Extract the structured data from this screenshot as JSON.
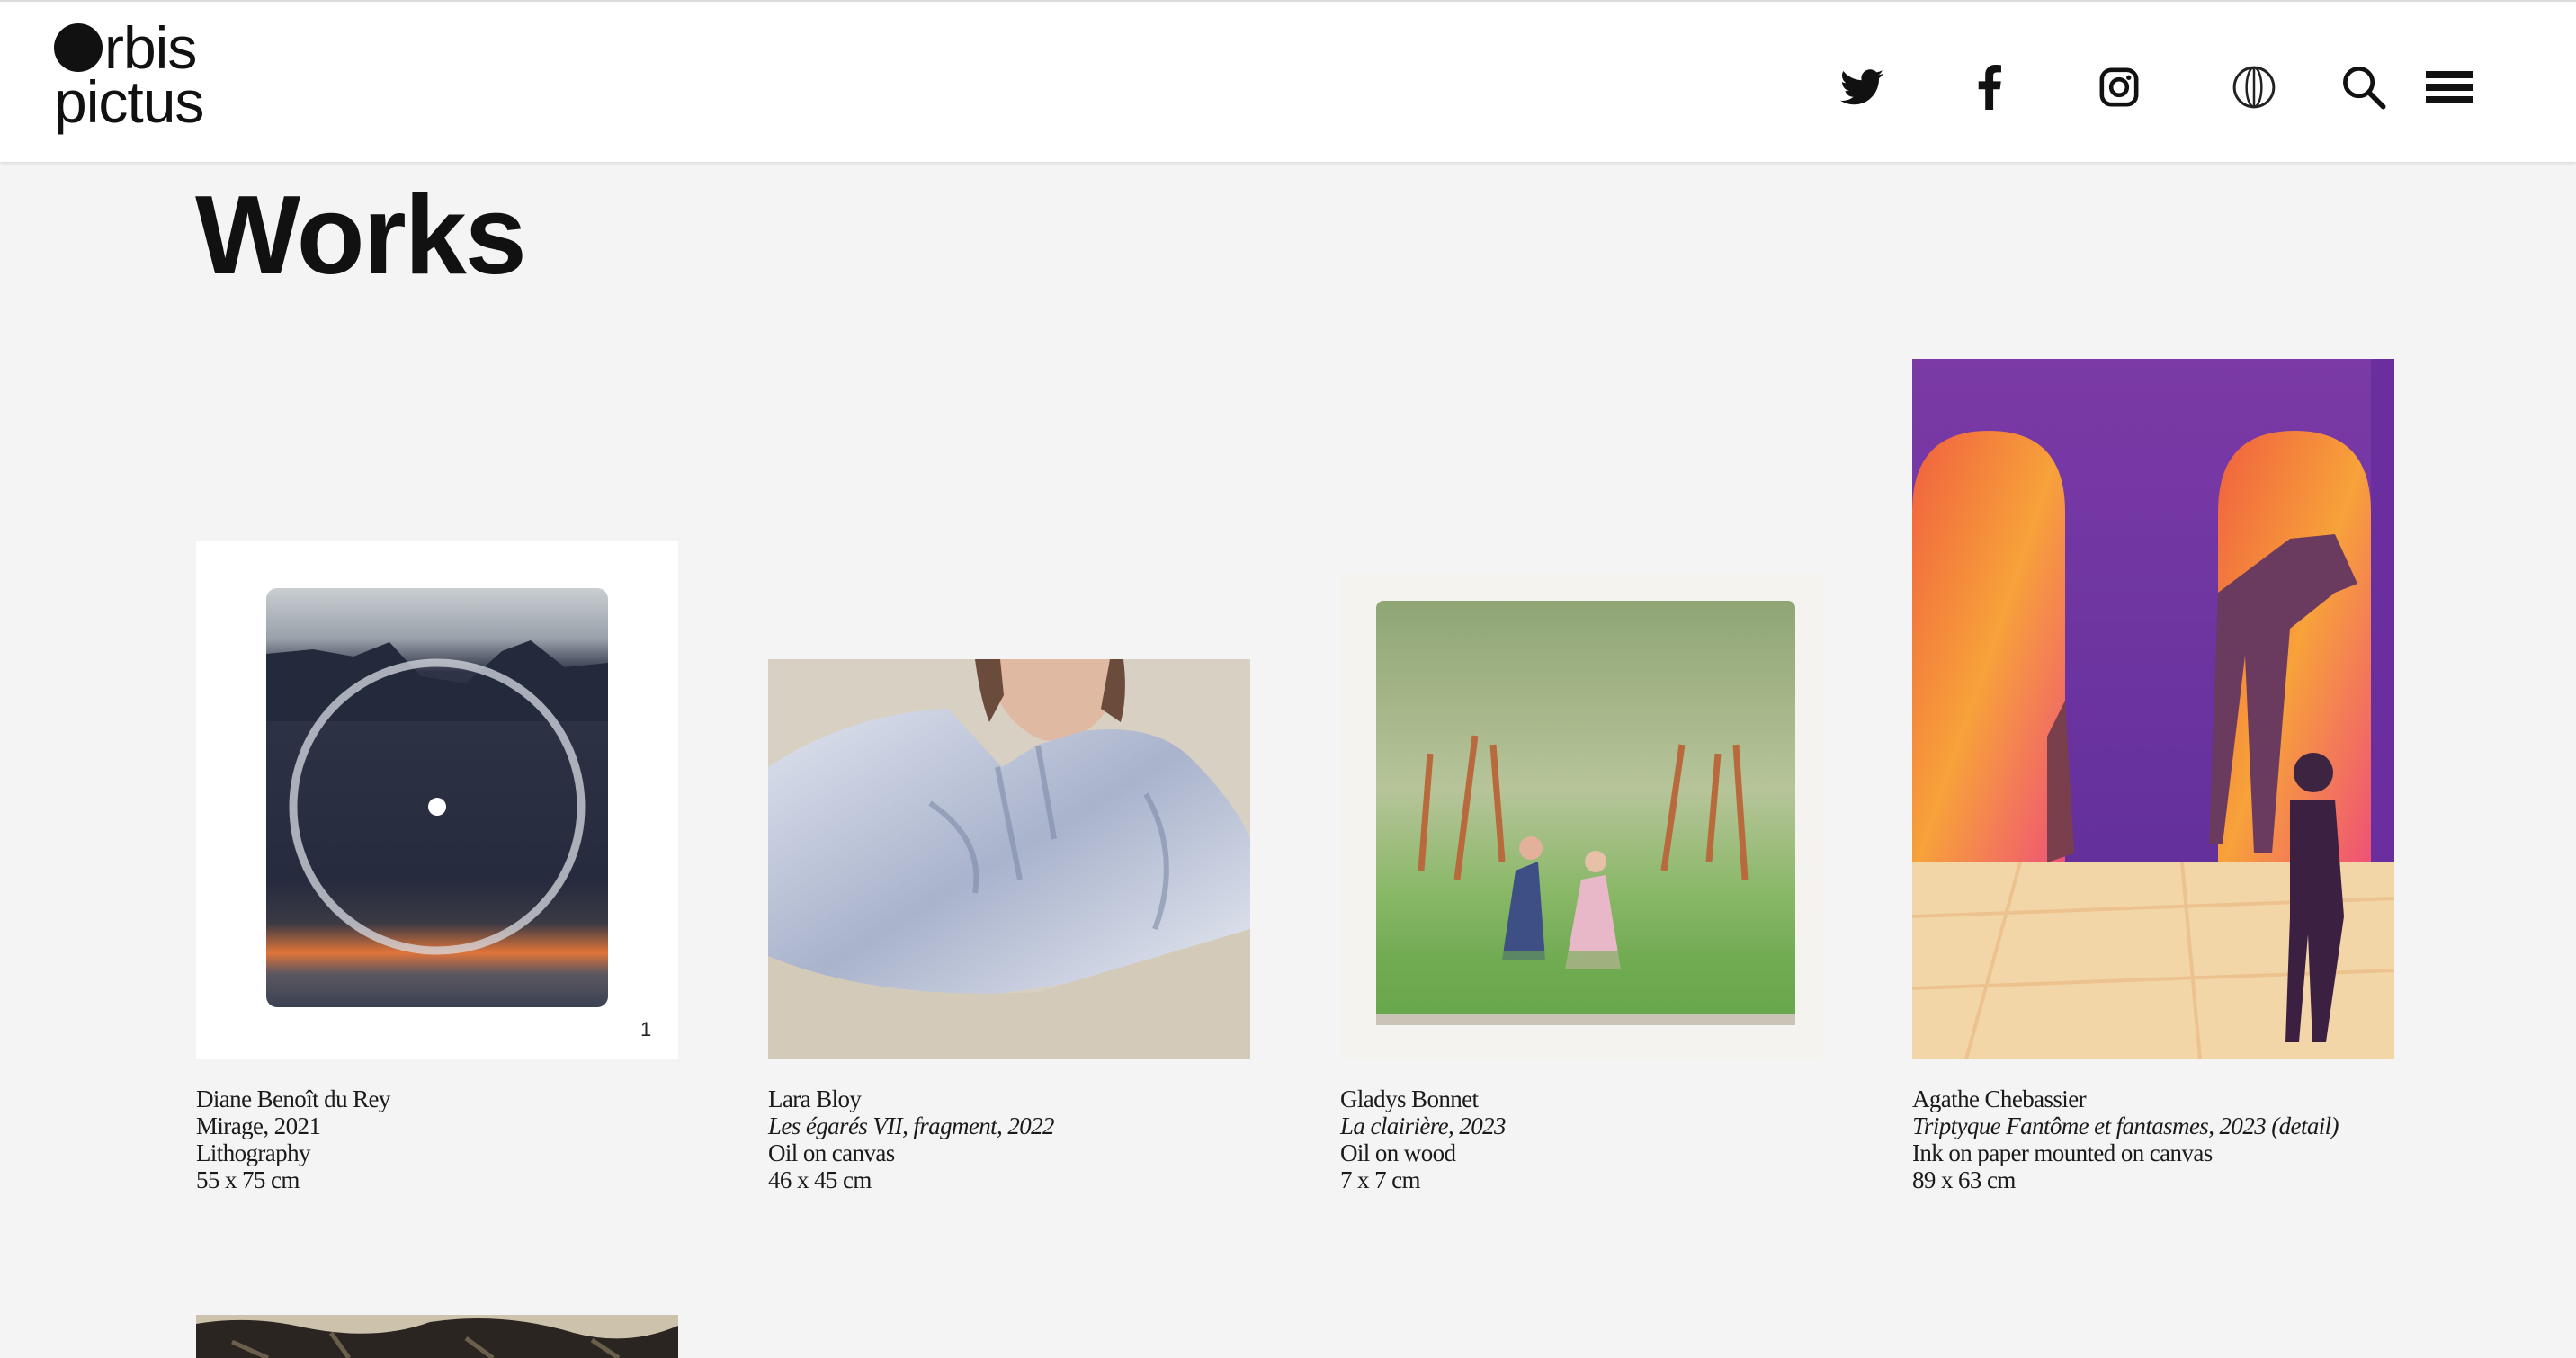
{
  "brand": {
    "logo_line1": "rbis",
    "logo_line2": "pictus"
  },
  "header": {
    "icons": [
      "twitter-icon",
      "facebook-icon",
      "instagram-icon",
      "contrast-icon",
      "search-icon",
      "menu-icon"
    ]
  },
  "page": {
    "title": "Works"
  },
  "works": [
    {
      "artist": "Diane Benoît du Rey",
      "title": "Mirage, 2021",
      "medium": "Lithography",
      "size": "55 x 75 cm",
      "badge": "1"
    },
    {
      "artist": "Lara Bloy",
      "title": "Les égarés VII, fragment, 2022",
      "medium": "Oil on canvas",
      "size": "46 x 45 cm"
    },
    {
      "artist": "Gladys Bonnet",
      "title": "La clairière, 2023",
      "medium": "Oil on wood",
      "size": "7 x 7 cm"
    },
    {
      "artist": "Agathe Chebassier",
      "title": "Triptyque Fantôme et fantasmes, 2023 (detail)",
      "medium": "Ink on paper mounted on canvas",
      "size": "89 x 63 cm"
    }
  ],
  "colors": {
    "background": "#f4f4f4",
    "header": "#ffffff",
    "text": "#111111"
  }
}
